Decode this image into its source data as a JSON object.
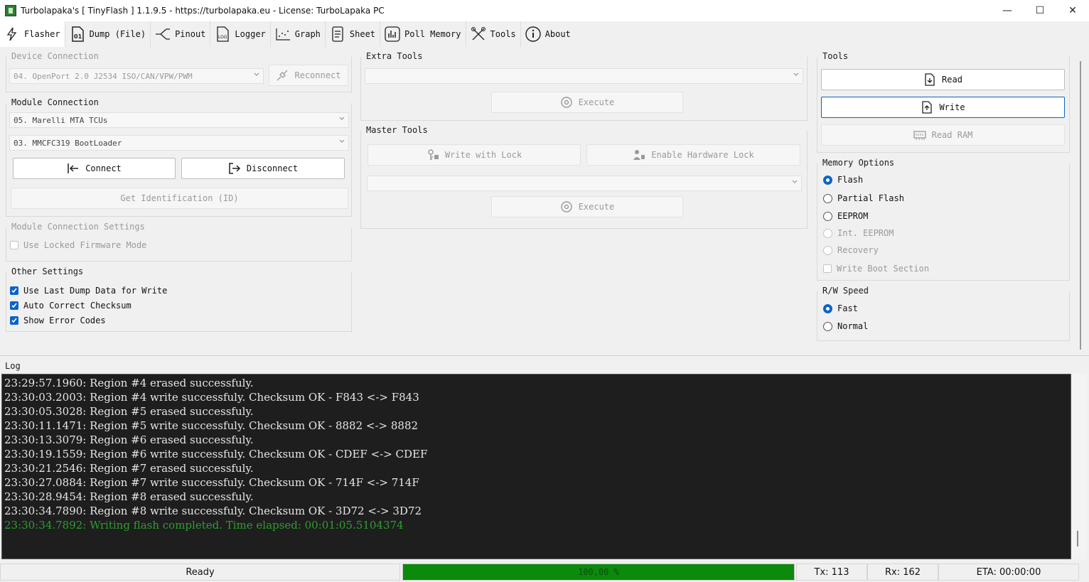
{
  "window": {
    "title": "Turbolapaka's [ TinyFlash ] 1.1.9.5 - https://turbolapaka.eu - License: TurboLapaka PC",
    "minimize": "—",
    "maximize": "☐",
    "close": "✕"
  },
  "tabs": [
    {
      "label": "Flasher",
      "icon": "lightning-icon",
      "active": true
    },
    {
      "label": "Dump (File)",
      "icon": "file-binary-icon"
    },
    {
      "label": "Pinout",
      "icon": "pinout-icon"
    },
    {
      "label": "Logger",
      "icon": "log-file-icon"
    },
    {
      "label": "Graph",
      "icon": "graph-icon"
    },
    {
      "label": "Sheet",
      "icon": "sheet-icon"
    },
    {
      "label": "Poll Memory",
      "icon": "bar-chart-icon"
    },
    {
      "label": "Tools",
      "icon": "tools-icon"
    },
    {
      "label": "About",
      "icon": "info-icon"
    }
  ],
  "device_connection": {
    "title": "Device Connection",
    "device": "04. OpenPort 2.0 J2534 ISO/CAN/VPW/PWM",
    "reconnect": "Reconnect"
  },
  "module_connection": {
    "title": "Module Connection",
    "module": "05. Marelli MTA TCUs",
    "bootloader": "03. MMCFC319 BootLoader",
    "connect": "Connect",
    "disconnect": "Disconnect",
    "get_id": "Get Identification (ID)"
  },
  "module_settings": {
    "title": "Module Connection Settings",
    "locked_firmware": "Use Locked Firmware Mode"
  },
  "other_settings": {
    "title": "Other Settings",
    "use_last_dump": "Use Last Dump Data for Write",
    "auto_checksum": "Auto Correct Checksum",
    "show_errors": "Show Error Codes"
  },
  "extra_tools": {
    "title": "Extra Tools",
    "execute": "Execute"
  },
  "master_tools": {
    "title": "Master Tools",
    "write_lock": "Write with Lock",
    "hw_lock": "Enable Hardware Lock",
    "execute": "Execute"
  },
  "tools": {
    "title": "Tools",
    "read": "Read",
    "write": "Write",
    "read_ram": "Read RAM"
  },
  "memory_options": {
    "title": "Memory Options",
    "flash": "Flash",
    "partial_flash": "Partial Flash",
    "eeprom": "EEPROM",
    "int_eeprom": "Int. EEPROM",
    "recovery": "Recovery",
    "write_boot": "Write Boot Section"
  },
  "rw_speed": {
    "title": "R/W Speed",
    "fast": "Fast",
    "normal": "Normal"
  },
  "log": {
    "label": "Log",
    "lines": [
      "23:29:57.1960: Region #4 erased successfuly.",
      "23:30:03.2003: Region #4 write successfuly. Checksum OK - F843 <-> F843",
      "23:30:05.3028: Region #5 erased successfuly.",
      "23:30:11.1471: Region #5 write successfuly. Checksum OK - 8882 <-> 8882",
      "23:30:13.3079: Region #6 erased successfuly.",
      "23:30:19.1559: Region #6 write successfuly. Checksum OK - CDEF <-> CDEF",
      "23:30:21.2546: Region #7 erased successfuly.",
      "23:30:27.0884: Region #7 write successfuly. Checksum OK - 714F <-> 714F",
      "23:30:28.9454: Region #8 erased successfuly.",
      "23:30:34.7890: Region #8 write successfuly. Checksum OK - 3D72 <-> 3D72"
    ],
    "final_line": "23:30:34.7892: Writing flash completed. Time elapsed: 00:01:05.5104374"
  },
  "status": {
    "state": "Ready",
    "progress_text": "100,00 %",
    "progress_fraction": 1.0,
    "tx": "Tx: 113",
    "rx": "Rx: 162",
    "eta": "ETA: 00:00:00"
  },
  "colors": {
    "accent": "#0a64c8",
    "progress": "#0b8a0b",
    "log_bg": "#1e1e1e",
    "log_ok": "#2e9e2e"
  }
}
